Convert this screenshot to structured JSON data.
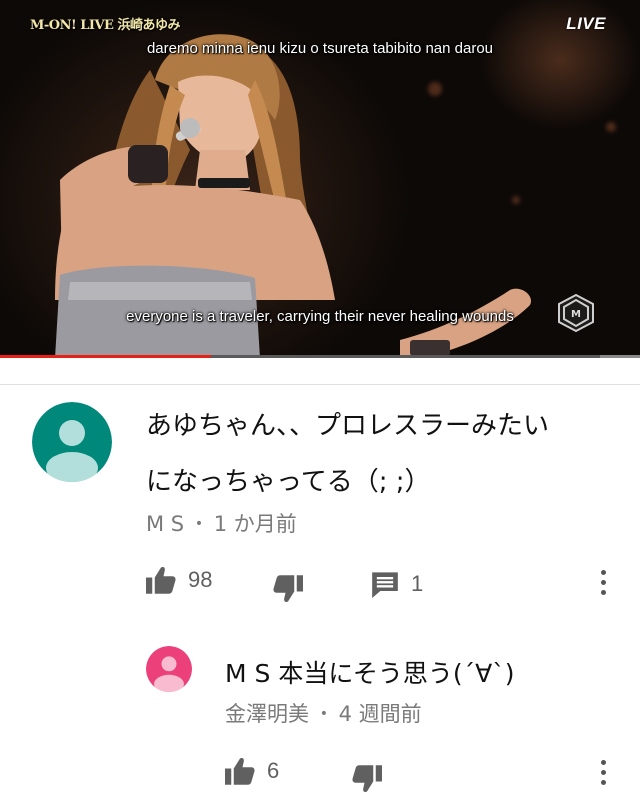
{
  "video": {
    "overlay_label": "M-ON! LIVE 浜崎あゆみ",
    "live_label": "LIVE",
    "subtitle_top": "daremo minna ienu kizu o tsureta tabibito nan darou",
    "subtitle_bottom": "everyone is a traveler, carrying their never healing wounds",
    "progress": 0.33,
    "channel_logo_icon": "m-on-logo-icon"
  },
  "comment": {
    "text_line1": "あゆちゃん、、プロレスラーみたい",
    "text_line2": "になっちゃってる（; ;）",
    "author": "M S",
    "separator": "•",
    "time": "1 か月前",
    "like_count": "98",
    "reply_count": "1",
    "avatar_color": "#00897b"
  },
  "reply": {
    "text": "M S 本当にそう思う(´∀`)",
    "author": "金澤明美",
    "separator": "•",
    "time": "4 週間前",
    "like_count": "6",
    "avatar_color": "#ec407a"
  },
  "colors": {
    "progress_red": "#e62117",
    "icon_gray": "#606060"
  }
}
